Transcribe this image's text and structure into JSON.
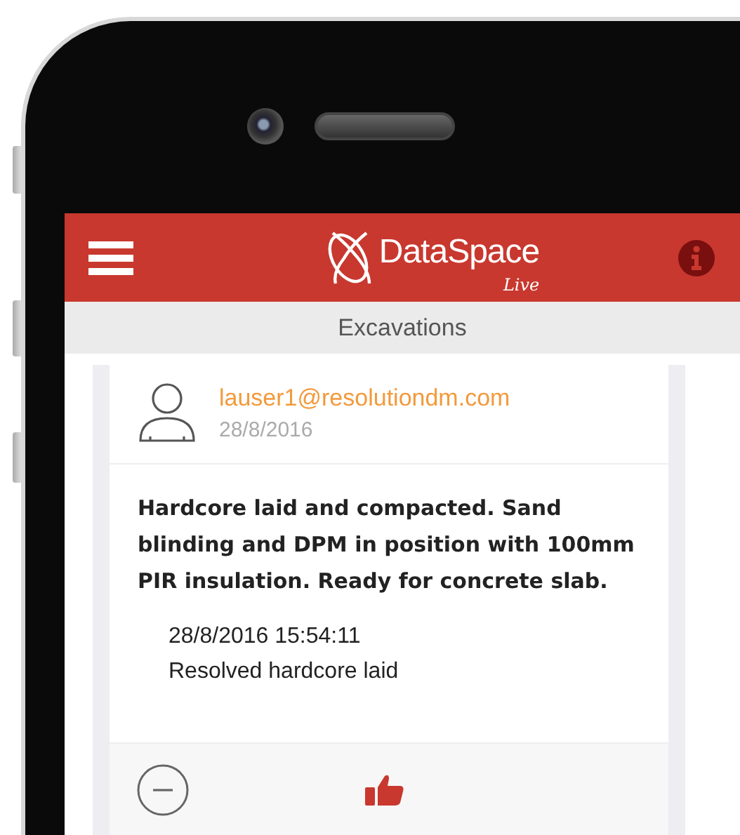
{
  "header": {
    "logo_text": "DataSpace",
    "logo_subtext": "Live"
  },
  "subheader": {
    "title": "Excavations"
  },
  "post": {
    "author": "lauser1@resolutiondm.com",
    "date": "28/8/2016",
    "message": "Hardcore laid and compacted. Sand blinding and DPM in position with 100mm PIR insulation. Ready for concrete slab.",
    "entries": [
      {
        "timestamp": "28/8/2016 15:54:11",
        "text": "Resolved hardcore laid"
      }
    ],
    "liked": true
  }
}
